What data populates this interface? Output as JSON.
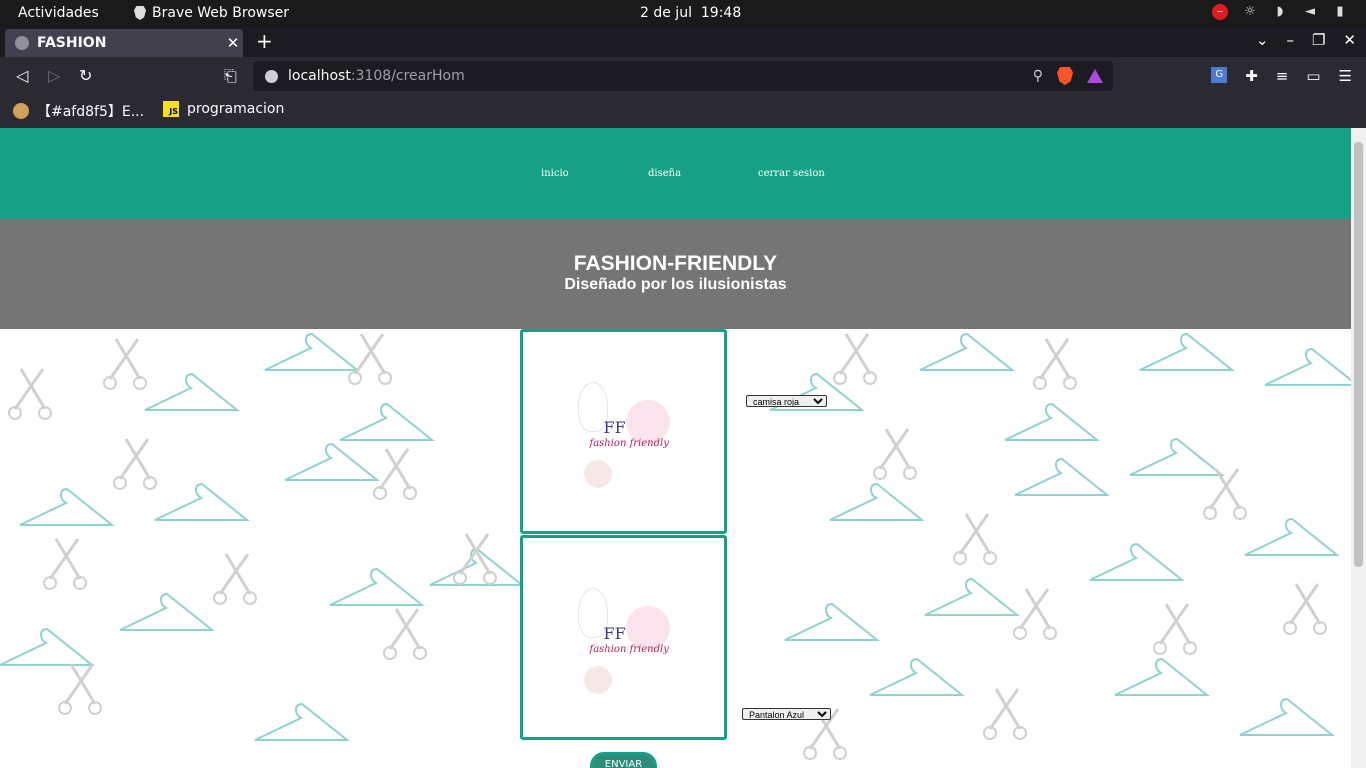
{
  "system_bar": {
    "activities": "Actividades",
    "app_name": "Brave Web Browser",
    "date": "2 de jul",
    "time": "19:48"
  },
  "browser": {
    "tab_title": "FASHION",
    "url_host": "localhost",
    "url_path": ":3108/crearHom",
    "bookmarks": [
      {
        "label": "【#afd8f5】E..."
      },
      {
        "label": "programacion"
      }
    ]
  },
  "page": {
    "nav": {
      "inicio": "inicio",
      "disena": "diseña",
      "cerrar": "cerrar sesion"
    },
    "hero": {
      "title": "FASHION-FRIENDLY",
      "subtitle": "Diseñado por los ilusionistas"
    },
    "logo_text": {
      "ff": "FF",
      "name": "fashion friendly"
    },
    "select_top": {
      "selected": "camisa roja"
    },
    "select_bottom": {
      "selected": "Pantalon Azul"
    },
    "send_button": "ENVIAR"
  },
  "colors": {
    "accent": "#16a085",
    "hero_bg": "#757575"
  }
}
